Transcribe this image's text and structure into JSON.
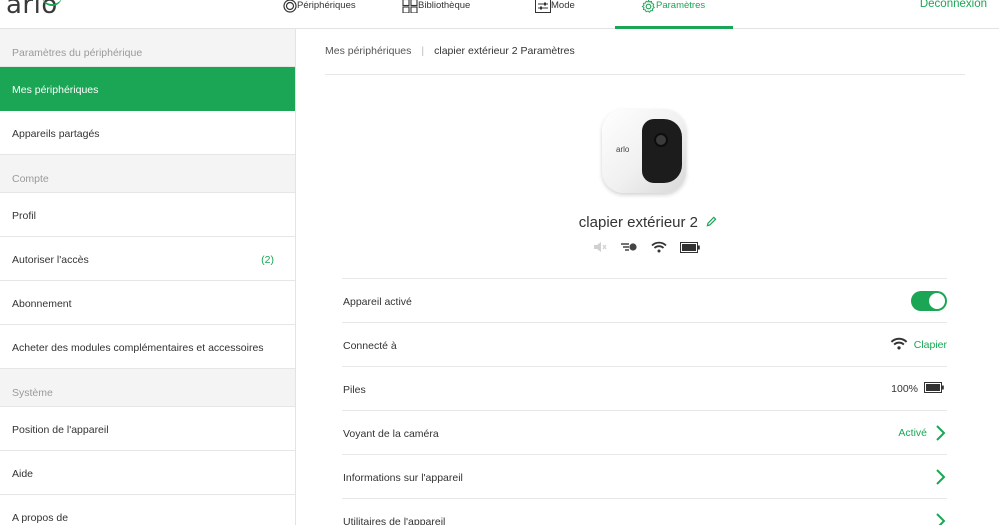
{
  "header": {
    "logo": "arlo",
    "nav": [
      {
        "label": "Périphériques",
        "icon": "devices-icon"
      },
      {
        "label": "Bibliothèque",
        "icon": "library-grid-icon"
      },
      {
        "label": "Mode",
        "icon": "mode-sliders-icon"
      },
      {
        "label": "Paramètres",
        "icon": "settings-gear-icon",
        "active": true
      }
    ],
    "logout": "Déconnexion"
  },
  "sidebar": {
    "sections": [
      {
        "title": "Paramètres du périphérique",
        "items": [
          {
            "label": "Mes périphériques",
            "active": true
          },
          {
            "label": "Appareils partagés"
          }
        ]
      },
      {
        "title": "Compte",
        "items": [
          {
            "label": "Profil"
          },
          {
            "label": "Autoriser l'accès",
            "count": "(2)"
          },
          {
            "label": "Abonnement"
          },
          {
            "label": "Acheter des modules complémentaires et accessoires"
          }
        ]
      },
      {
        "title": "Système",
        "items": [
          {
            "label": "Position de l'appareil"
          },
          {
            "label": "Aide"
          },
          {
            "label": "A propos de"
          }
        ]
      }
    ]
  },
  "breadcrumb": {
    "root": "Mes périphériques",
    "separator": "|",
    "current": "clapier extérieur 2 Paramètres"
  },
  "device": {
    "name": "clapier extérieur 2",
    "camera_logo": "arlo",
    "status_icons": [
      "speaker-muted-icon",
      "motion-detect-icon",
      "wifi-icon",
      "battery-icon"
    ]
  },
  "settings": [
    {
      "label": "Appareil activé",
      "type": "toggle",
      "value": "on"
    },
    {
      "label": "Connecté à",
      "type": "value",
      "icon": "wifi-icon",
      "value": "Clapier"
    },
    {
      "label": "Piles",
      "type": "value",
      "icon": "battery-icon",
      "value": "100%"
    },
    {
      "label": "Voyant de la caméra",
      "type": "link",
      "value": "Activé"
    },
    {
      "label": "Informations sur l'appareil",
      "type": "link"
    },
    {
      "label": "Utilitaires de l'appareil",
      "type": "link"
    }
  ],
  "colors": {
    "accent": "#1aa655",
    "sidebar_section_bg": "#f4f4f4",
    "divider": "#e6e6e6"
  }
}
